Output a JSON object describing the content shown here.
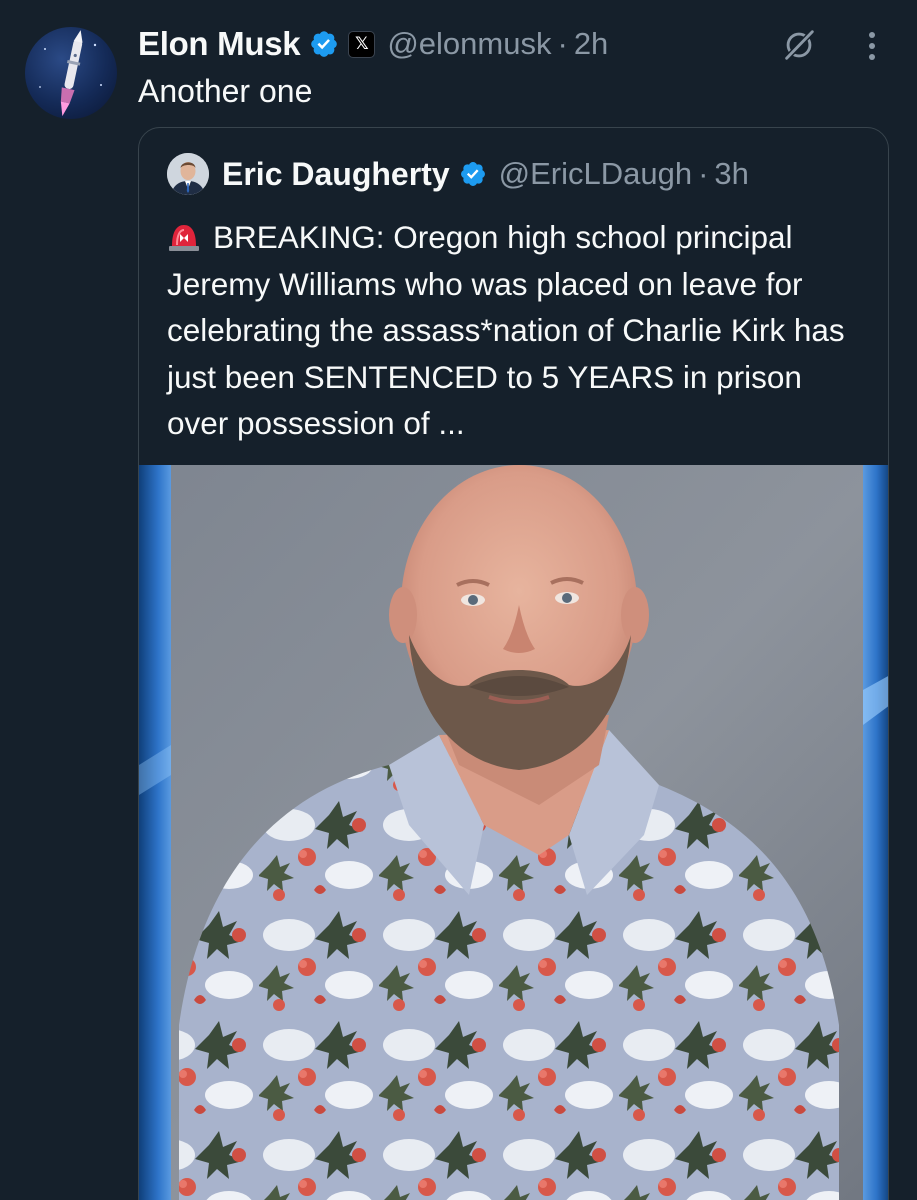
{
  "author": {
    "display_name": "Elon Musk",
    "handle": "@elonmusk",
    "separator": "·",
    "time": "2h",
    "x_badge": "𝕏",
    "avatar_icon": "rocket-avatar-icon",
    "verified_icon": "verified-badge-icon"
  },
  "tweet": {
    "text": "Another one"
  },
  "actions": {
    "grok_icon": "grok-icon",
    "more_icon": "more-vertical-icon"
  },
  "quoted": {
    "display_name": "Eric Daugherty",
    "handle": "@EricLDaugh",
    "separator": "·",
    "time": "3h",
    "siren_icon": "siren-emoji-icon",
    "text": "BREAKING: Oregon high school principal Jeremy Williams who was placed on leave for celebrating the assass*nation of Charlie Kirk has just been SENTENCED to 5 YEARS in prison over possession of ...",
    "media": "portrait-photo"
  },
  "colors": {
    "background": "#15202b",
    "text_primary": "#f7f9f9",
    "text_secondary": "#8b98a5",
    "border": "#38444d",
    "verified_blue": "#1d9bf0"
  }
}
